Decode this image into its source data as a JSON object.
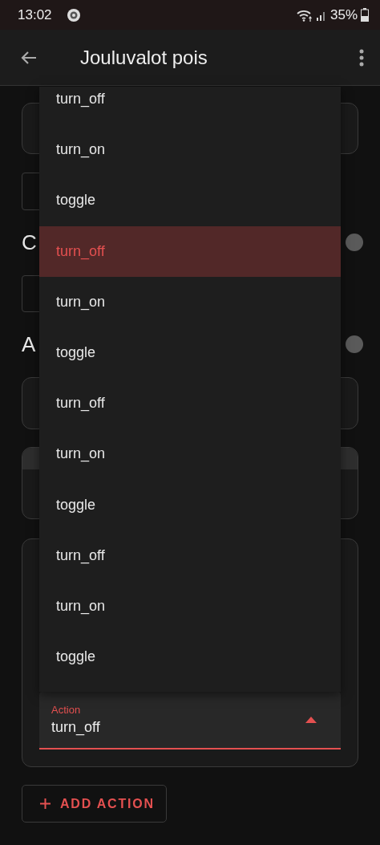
{
  "status_bar": {
    "time": "13:02",
    "battery": "35%"
  },
  "app_bar": {
    "title": "Jouluvalot pois"
  },
  "sections": [
    {
      "heading": "C"
    },
    {
      "heading": "A"
    }
  ],
  "menu": {
    "options": [
      {
        "label": "turn_off",
        "selected": false
      },
      {
        "label": "turn_on",
        "selected": false
      },
      {
        "label": "toggle",
        "selected": false
      },
      {
        "label": "turn_off",
        "selected": true
      },
      {
        "label": "turn_on",
        "selected": false
      },
      {
        "label": "toggle",
        "selected": false
      },
      {
        "label": "turn_off",
        "selected": false
      },
      {
        "label": "turn_on",
        "selected": false
      },
      {
        "label": "toggle",
        "selected": false
      },
      {
        "label": "turn_off",
        "selected": false
      },
      {
        "label": "turn_on",
        "selected": false
      },
      {
        "label": "toggle",
        "selected": false
      }
    ]
  },
  "action_select": {
    "label": "Action",
    "value": "turn_off",
    "expanded": true
  },
  "add_button": {
    "label": "ADD ACTION"
  }
}
